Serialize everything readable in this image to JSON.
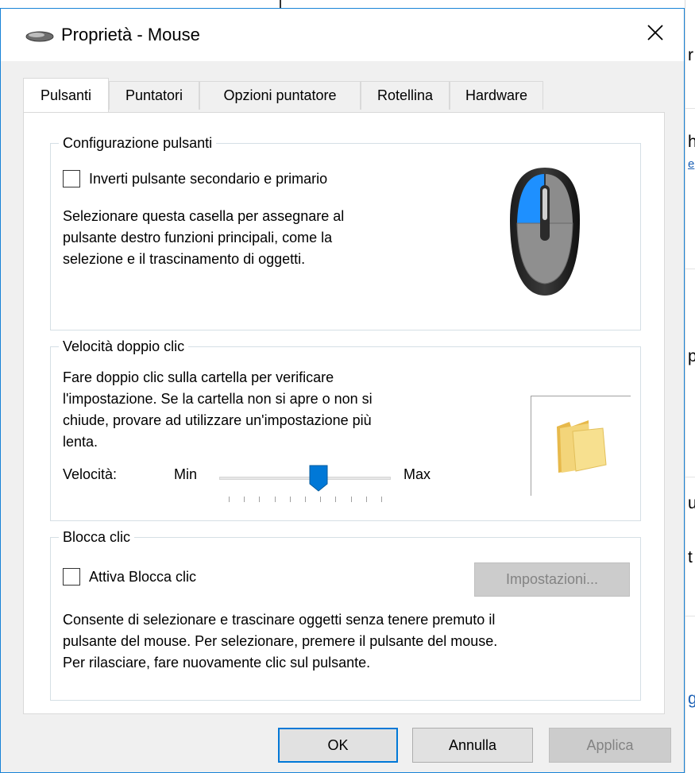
{
  "window": {
    "title": "Proprietà - Mouse",
    "close_icon": "close-icon",
    "app_icon": "mouse-icon"
  },
  "tabs": [
    {
      "label": "Pulsanti",
      "active": true
    },
    {
      "label": "Puntatori",
      "active": false
    },
    {
      "label": "Opzioni puntatore",
      "active": false
    },
    {
      "label": "Rotellina",
      "active": false
    },
    {
      "label": "Hardware",
      "active": false
    }
  ],
  "button_config": {
    "title": "Configurazione pulsanti",
    "checkbox_label": "Inverti pulsante secondario e primario",
    "checked": false,
    "description": [
      "Selezionare questa casella per assegnare al",
      "pulsante destro funzioni principali, come la",
      "selezione e il trascinamento di oggetti."
    ]
  },
  "double_click": {
    "title": "Velocità doppio clic",
    "description": [
      "Fare doppio clic sulla cartella per verificare",
      "l'impostazione. Se la cartella non si apre o non si",
      "chiude, provare ad utilizzare un'impostazione più",
      "lenta."
    ],
    "speed_label": "Velocità:",
    "min_label": "Min",
    "max_label": "Max",
    "slider_value_fraction": 0.58
  },
  "click_lock": {
    "title": "Blocca clic",
    "checkbox_label": "Attiva Blocca clic",
    "checked": false,
    "settings_button": "Impostazioni...",
    "description": [
      "Consente di selezionare e trascinare oggetti senza tenere premuto il",
      "pulsante del mouse. Per selezionare, premere il pulsante del mouse.",
      "Per rilasciare, fare nuovamente clic sul pulsante."
    ]
  },
  "footer": {
    "ok": "OK",
    "cancel": "Annulla",
    "apply": "Applica"
  },
  "background_window": {
    "fragments": [
      "r",
      "h",
      "e",
      "p",
      "u",
      "t",
      "g"
    ]
  },
  "colors": {
    "accent": "#0078d7",
    "mouse_highlight": "#1e90ff",
    "folder": "#f3d57a"
  }
}
